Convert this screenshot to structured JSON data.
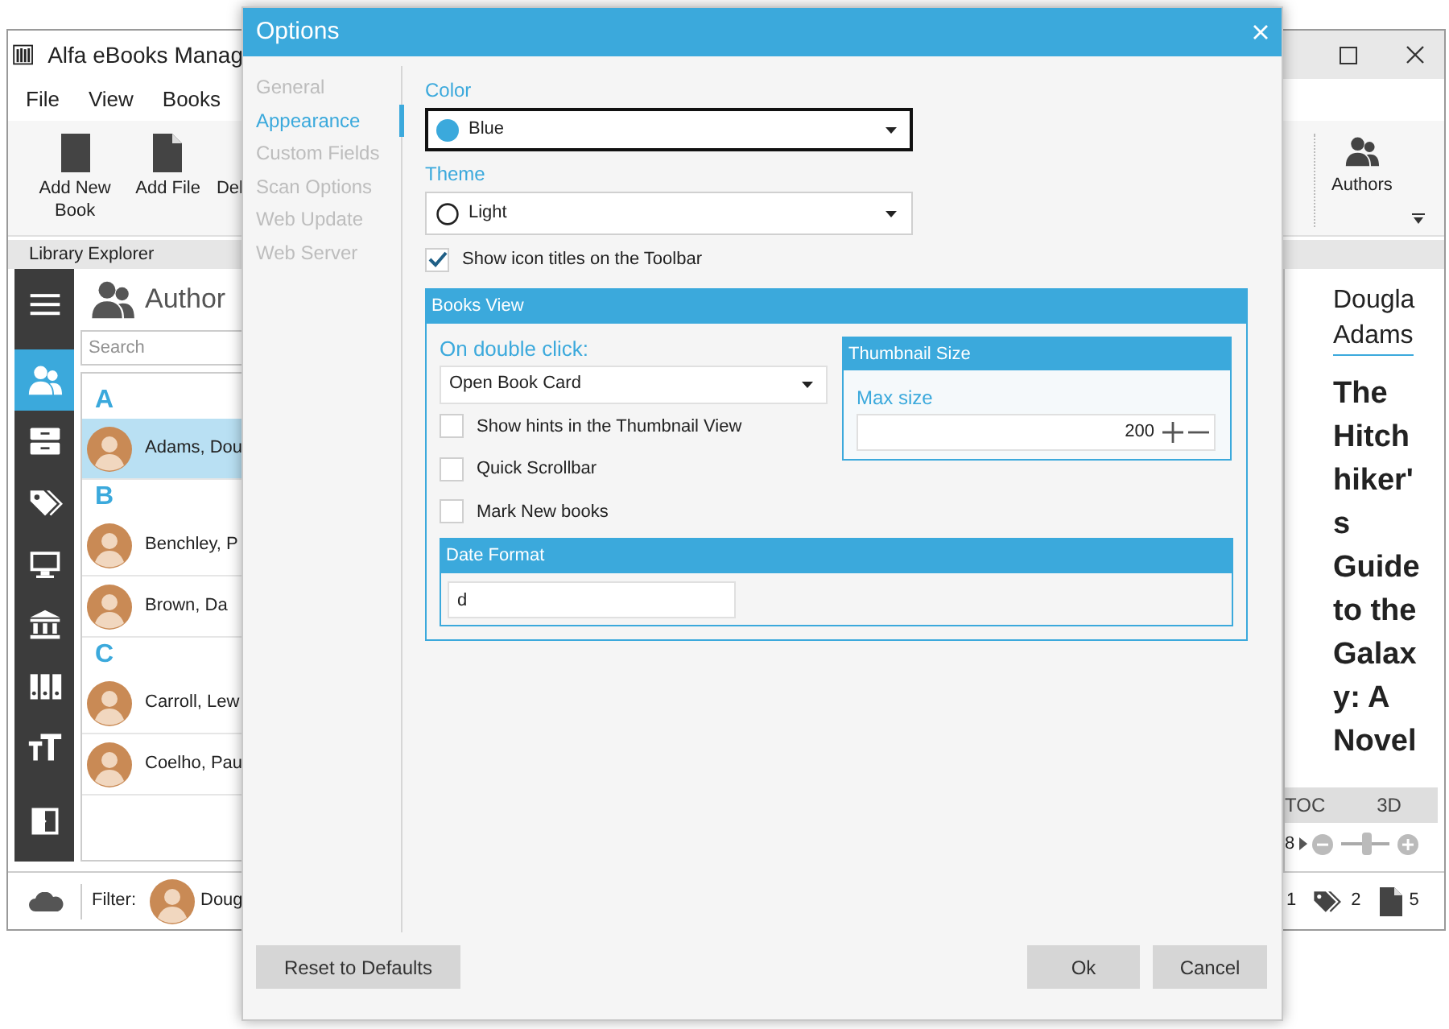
{
  "main_window": {
    "title": "Alfa eBooks Manag",
    "menu": [
      "File",
      "View",
      "Books"
    ],
    "toolbar_left": [
      {
        "kind": "book",
        "label": "Add New Book"
      },
      {
        "kind": "file",
        "label": "Add File"
      },
      {
        "kind": "text",
        "label": "Del"
      }
    ],
    "toolbar_right": [
      {
        "kind": "authors",
        "label": "Authors"
      }
    ],
    "panel_title": "Library Explorer",
    "sidebar": [
      {
        "kind": "menu",
        "selected": false
      },
      {
        "kind": "authors",
        "selected": true
      },
      {
        "kind": "cabinet",
        "selected": false
      },
      {
        "kind": "tags",
        "selected": false
      },
      {
        "kind": "monitor",
        "selected": false
      },
      {
        "kind": "library",
        "selected": false
      },
      {
        "kind": "binders",
        "selected": false
      },
      {
        "kind": "font",
        "selected": false
      },
      {
        "kind": "exit",
        "selected": false
      }
    ],
    "authors_panel": {
      "title": "Author",
      "search": {
        "placeholder": "Search"
      },
      "groups": [
        {
          "letter": "A",
          "authors": [
            {
              "name": "Adams, Dou",
              "selected": true
            }
          ]
        },
        {
          "letter": "B",
          "authors": [
            {
              "name": "Benchley, P",
              "selected": false
            },
            {
              "name": "Brown, Da",
              "selected": false
            }
          ]
        },
        {
          "letter": "C",
          "authors": [
            {
              "name": "Carroll, Lew",
              "selected": false
            },
            {
              "name": "Coelho, Pau",
              "selected": false
            }
          ]
        }
      ]
    },
    "filter": {
      "label": "Filter:",
      "value": "Doug"
    },
    "details": {
      "author_lines": [
        "Dougla",
        "Adams"
      ],
      "title_lines": [
        "The",
        "Hitch",
        "hiker'",
        "s",
        "Guide",
        "to the",
        "Galax",
        "y: A",
        "Novel"
      ],
      "tabs": [
        "TOC",
        "3D"
      ],
      "zoom": {
        "value": "8",
        "level": 0.55
      }
    },
    "status_counts": [
      {
        "kind": "plain",
        "value": "1"
      },
      {
        "kind": "tag",
        "value": "2"
      },
      {
        "kind": "file",
        "value": "5"
      }
    ]
  },
  "dialog": {
    "title": "Options",
    "nav": [
      {
        "label": "General",
        "selected": false
      },
      {
        "label": "Appearance",
        "selected": true
      },
      {
        "label": "Custom Fields",
        "selected": false
      },
      {
        "label": "Scan Options",
        "selected": false
      },
      {
        "label": "Web Update",
        "selected": false
      },
      {
        "label": "Web Server",
        "selected": false
      }
    ],
    "color": {
      "label": "Color",
      "value": "Blue"
    },
    "theme": {
      "label": "Theme",
      "value": "Light"
    },
    "show_icon_titles": {
      "label": "Show icon titles on the Toolbar",
      "checked": true
    },
    "books_view": {
      "title": "Books View",
      "double_click": {
        "label": "On double click:",
        "value": "Open Book Card"
      },
      "options": [
        {
          "label": "Show hints in the Thumbnail View",
          "checked": false
        },
        {
          "label": "Quick Scrollbar",
          "checked": false
        },
        {
          "label": "Mark New books",
          "checked": false
        }
      ],
      "thumbnail_size": {
        "title": "Thumbnail Size",
        "label": "Max size",
        "value": "200"
      },
      "date_format": {
        "title": "Date Format",
        "value": "d"
      }
    },
    "buttons": {
      "reset": "Reset to Defaults",
      "ok": "Ok",
      "cancel": "Cancel"
    }
  }
}
